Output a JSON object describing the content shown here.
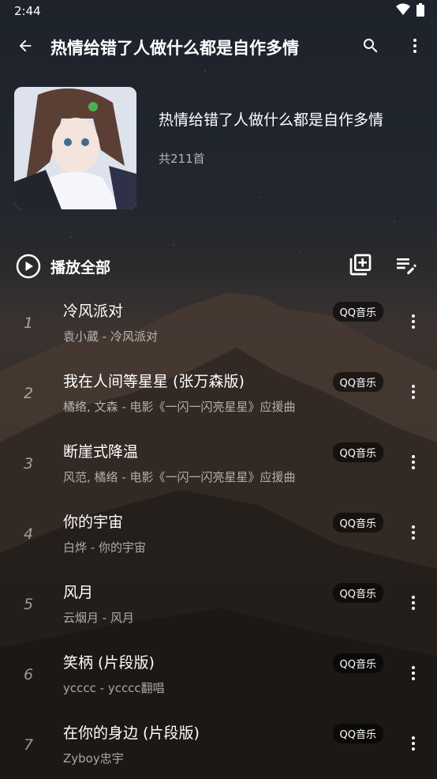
{
  "status": {
    "time": "2:44"
  },
  "toolbar": {
    "title": "热情给错了人做什么都是自作多情"
  },
  "playlist": {
    "name": "热情给错了人做什么都是自作多情",
    "count": "共211首"
  },
  "play_all": {
    "label": "播放全部"
  },
  "songs": [
    {
      "index": "1",
      "title": "冷风派对",
      "subtitle": "袁小葳 - 冷风派对",
      "source": "QQ音乐"
    },
    {
      "index": "2",
      "title": "我在人间等星星 (张万森版)",
      "subtitle": "橘络, 文森 - 电影《一闪一闪亮星星》应援曲",
      "source": "QQ音乐"
    },
    {
      "index": "3",
      "title": "断崖式降温",
      "subtitle": "风范, 橘络 - 电影《一闪一闪亮星星》应援曲",
      "source": "QQ音乐"
    },
    {
      "index": "4",
      "title": "你的宇宙",
      "subtitle": "白烨 - 你的宇宙",
      "source": "QQ音乐"
    },
    {
      "index": "5",
      "title": "风月",
      "subtitle": "云烟月 - 风月",
      "source": "QQ音乐"
    },
    {
      "index": "6",
      "title": "笑柄 (片段版)",
      "subtitle": "ycccc - ycccc翻唱",
      "source": "QQ音乐"
    },
    {
      "index": "7",
      "title": "在你的身边 (片段版)",
      "subtitle": "Zyboy忠宇",
      "source": "QQ音乐"
    }
  ],
  "icons": {
    "back": "arrow-left-icon",
    "search": "search-icon",
    "more": "more-vert-icon",
    "play": "play-circle-icon",
    "add_to_playlist": "library-add-icon",
    "edit_list": "playlist-edit-icon"
  }
}
